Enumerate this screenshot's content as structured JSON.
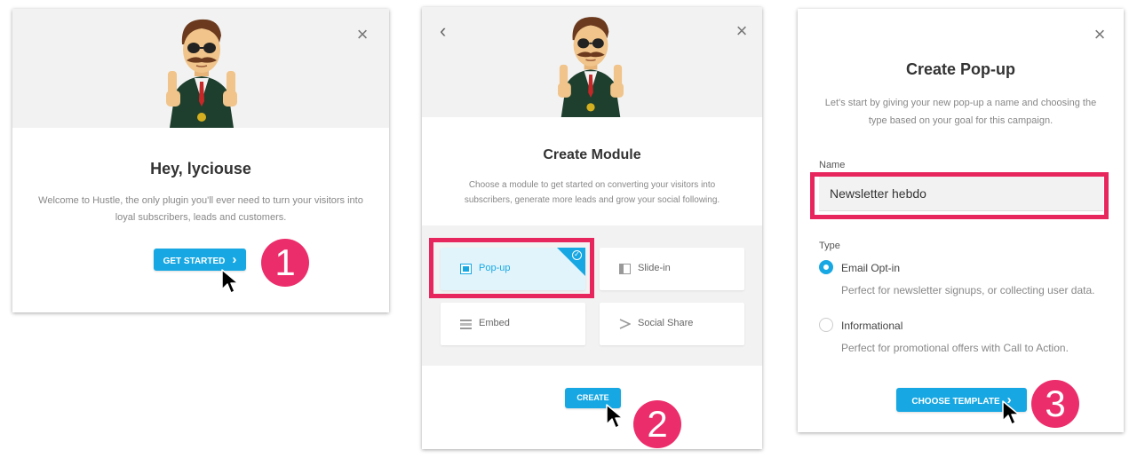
{
  "panel1": {
    "title": "Hey, lyciouse",
    "description": "Welcome to Hustle, the only plugin you'll ever need to turn your visitors into loyal subscribers, leads and customers.",
    "button_label": "GET STARTED",
    "step": "1"
  },
  "panel2": {
    "title": "Create Module",
    "description": "Choose a module to get started on converting your visitors into subscribers, generate more leads and grow your social following.",
    "modules": [
      {
        "label": "Pop-up",
        "icon": "popup-icon",
        "selected": true
      },
      {
        "label": "Slide-in",
        "icon": "slidein-icon",
        "selected": false
      },
      {
        "label": "Embed",
        "icon": "embed-icon",
        "selected": false
      },
      {
        "label": "Social Share",
        "icon": "share-icon",
        "selected": false
      }
    ],
    "button_label": "CREATE",
    "step": "2"
  },
  "panel3": {
    "title": "Create Pop-up",
    "description": "Let's start by giving your new pop-up a name and choosing the type based on your goal for this campaign.",
    "name_label": "Name",
    "name_value": "Newsletter hebdo",
    "type_label": "Type",
    "options": [
      {
        "label": "Email Opt-in",
        "description": "Perfect for newsletter signups, or collecting user data.",
        "selected": true
      },
      {
        "label": "Informational",
        "description": "Perfect for promotional offers with Call to Action.",
        "selected": false
      }
    ],
    "button_label": "CHOOSE TEMPLATE",
    "step": "3"
  },
  "colors": {
    "accent": "#17a8e3",
    "highlight": "#e8265e",
    "step_badge": "#ec2d6b"
  }
}
